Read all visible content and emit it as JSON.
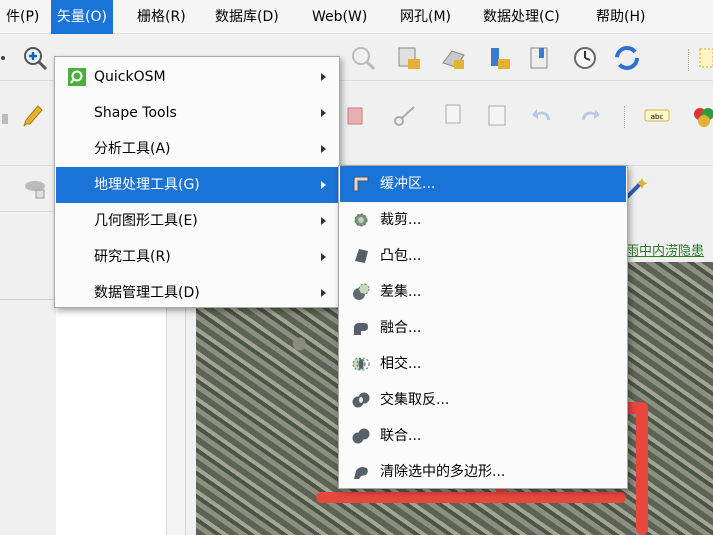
{
  "menubar": {
    "items": [
      {
        "label": "件(P)"
      },
      {
        "label": "矢量(O)"
      },
      {
        "label": "栅格(R)"
      },
      {
        "label": "数据库(D)"
      },
      {
        "label": "Web(W)"
      },
      {
        "label": "网孔(M)"
      },
      {
        "label": "数据处理(C)"
      },
      {
        "label": "帮助(H)"
      }
    ]
  },
  "vector_menu": {
    "items": [
      {
        "label": "QuickOSM"
      },
      {
        "label": "Shape Tools"
      },
      {
        "label": "分析工具(A)"
      },
      {
        "label": "地理处理工具(G)"
      },
      {
        "label": "几何图形工具(E)"
      },
      {
        "label": "研究工具(R)"
      },
      {
        "label": "数据管理工具(D)"
      }
    ]
  },
  "geoprocessing_menu": {
    "items": [
      {
        "label": "缓冲区..."
      },
      {
        "label": "裁剪..."
      },
      {
        "label": "凸包..."
      },
      {
        "label": "差集..."
      },
      {
        "label": "融合..."
      },
      {
        "label": "相交..."
      },
      {
        "label": "交集取反..."
      },
      {
        "label": "联合..."
      },
      {
        "label": "清除选中的多边形..."
      }
    ]
  },
  "map": {
    "link_text": "雨中内涝隐患"
  },
  "colors": {
    "highlight": "#1a73d6",
    "road": "#e8473c"
  }
}
